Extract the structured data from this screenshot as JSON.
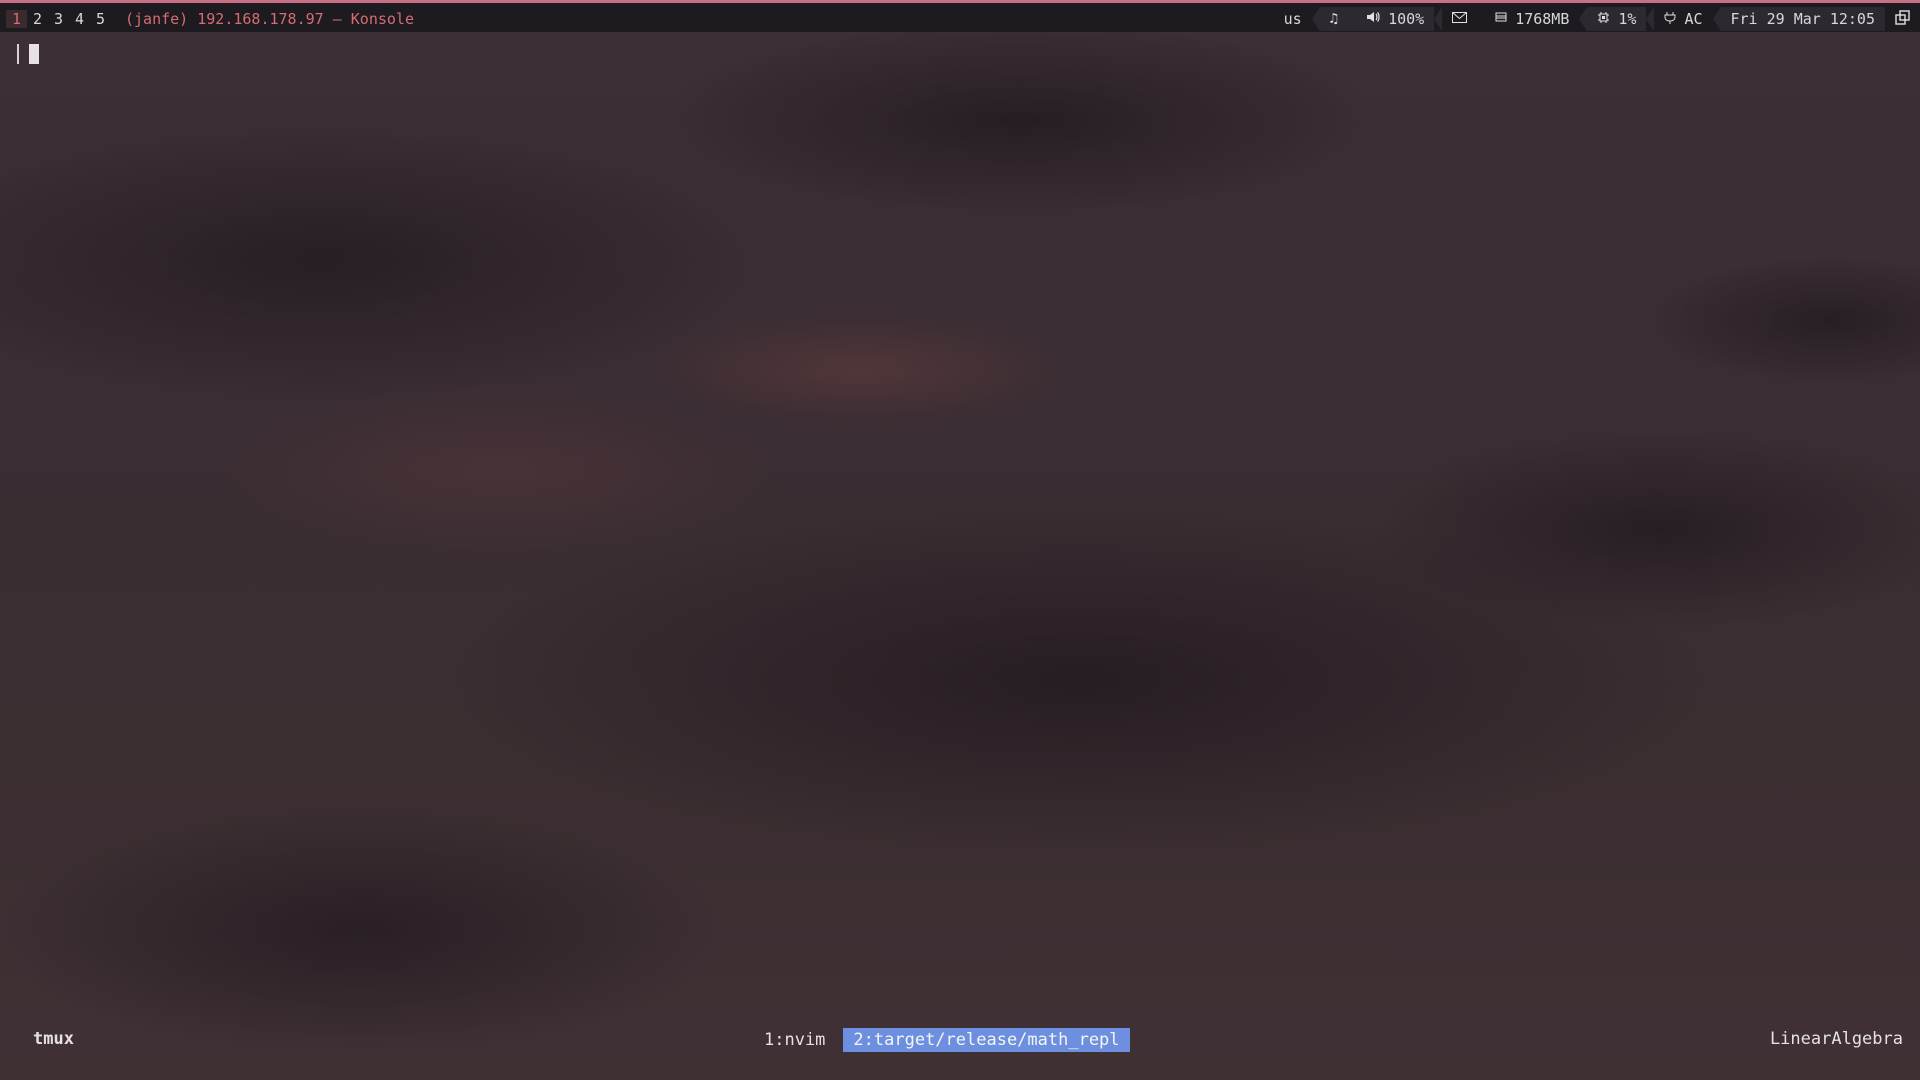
{
  "topbar": {
    "workspaces": [
      "1",
      "2",
      "3",
      "4",
      "5"
    ],
    "active_workspace": "1",
    "window_title": "(janfe) 192.168.178.97 — Konsole",
    "modules": {
      "keyboard_layout": "us",
      "music_icon": "music-note-icon",
      "volume": "100%",
      "mail_icon": "mail-icon",
      "memory": "1768MB",
      "cpu": "1%",
      "power": "AC",
      "datetime": "Fri 29 Mar 12:05"
    },
    "accent_color": "#c96f86",
    "title_color": "#d46c72"
  },
  "tmux": {
    "session": "tmux",
    "windows": [
      {
        "label": "1:nvim",
        "current": false
      },
      {
        "label": "2:target/release/math_repl",
        "current": true
      }
    ],
    "host": "LinearAlgebra",
    "current_color": "#6d8fe0"
  }
}
